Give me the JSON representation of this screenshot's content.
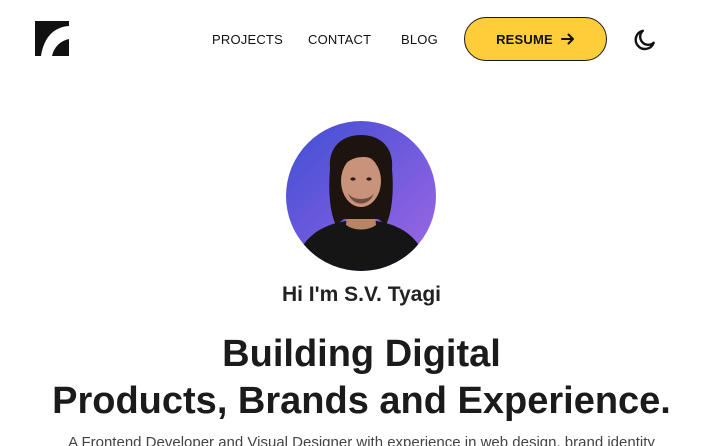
{
  "header": {
    "logo_icon": "brand-logo-icon",
    "nav": [
      {
        "label": "PROJECTS"
      },
      {
        "label": "CONTACT"
      },
      {
        "label": "BLOG"
      }
    ],
    "resume_label": "RESUME",
    "resume_icon": "arrow-right-icon",
    "theme_icon": "moon-icon"
  },
  "hero": {
    "greeting": "Hi I'm S.V. Tyagi",
    "headline_line1": "Building Digital",
    "headline_line2": "Products, Brands and Experience.",
    "intro": "A Frontend Developer and Visual Designer with experience in web design, brand identity"
  },
  "colors": {
    "accent": "#ffcd3a",
    "text": "#111111",
    "avatar_gradient_start": "#3f4fd4",
    "avatar_gradient_end": "#a168e4"
  }
}
